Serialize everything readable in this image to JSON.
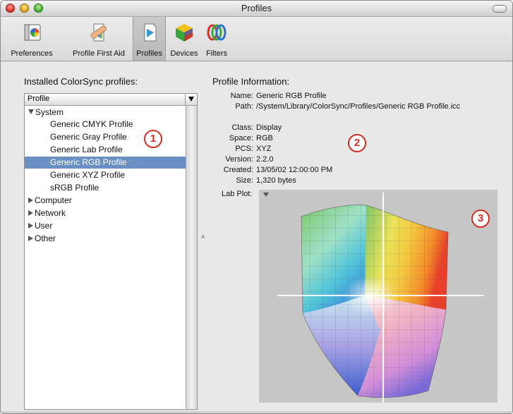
{
  "window": {
    "title": "Profiles"
  },
  "toolbar": {
    "items": [
      {
        "label": "Preferences",
        "icon": "preferences-icon"
      },
      {
        "label": "Profile First Aid",
        "icon": "first-aid-icon"
      },
      {
        "label": "Profiles",
        "icon": "profiles-icon",
        "selected": true
      },
      {
        "label": "Devices",
        "icon": "devices-icon"
      },
      {
        "label": "Filters",
        "icon": "filters-icon"
      }
    ]
  },
  "left": {
    "heading": "Installed ColorSync profiles:",
    "column_header": "Profile",
    "tree": [
      {
        "label": "System",
        "expanded": true
      },
      {
        "label": "Generic CMYK Profile"
      },
      {
        "label": "Generic Gray Profile"
      },
      {
        "label": "Generic Lab Profile"
      },
      {
        "label": "Generic RGB Profile",
        "selected": true
      },
      {
        "label": "Generic XYZ Profile"
      },
      {
        "label": "sRGB Profile"
      },
      {
        "label": "Computer",
        "expanded": false
      },
      {
        "label": "Network",
        "expanded": false
      },
      {
        "label": "User",
        "expanded": false
      },
      {
        "label": "Other",
        "expanded": false
      }
    ]
  },
  "right": {
    "heading": "Profile Information:",
    "fields": [
      {
        "label": "Name:",
        "value": "Generic RGB Profile"
      },
      {
        "label": "Path:",
        "value": "/System/Library/ColorSync/Profiles/Generic RGB Profile.icc"
      },
      {
        "label": "Class:",
        "value": "Display"
      },
      {
        "label": "Space:",
        "value": "RGB"
      },
      {
        "label": "PCS:",
        "value": "XYZ"
      },
      {
        "label": "Version:",
        "value": "2.2.0"
      },
      {
        "label": "Created:",
        "value": "13/05/02 12:00:00 PM"
      },
      {
        "label": "Size:",
        "value": "1,320 bytes"
      }
    ],
    "plot_label": "Lab Plot:"
  },
  "callouts": [
    "1",
    "2",
    "3"
  ],
  "colors": {
    "selection": "#6a8fc3",
    "callout": "#d32f24",
    "plot_bg": "#c6c6c6"
  }
}
